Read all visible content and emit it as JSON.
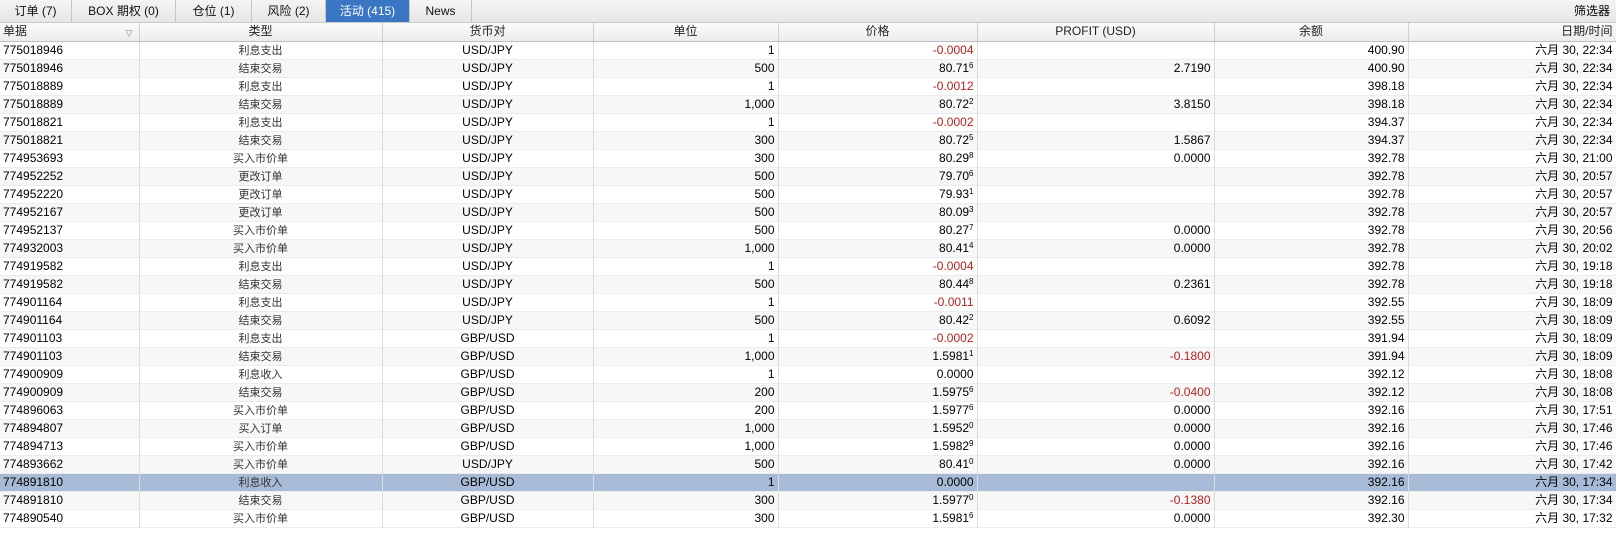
{
  "tabs": [
    {
      "label": "订单 (7)",
      "active": false
    },
    {
      "label": "BOX 期权 (0)",
      "active": false
    },
    {
      "label": "仓位 (1)",
      "active": false
    },
    {
      "label": "风险 (2)",
      "active": false
    },
    {
      "label": "活动 (415)",
      "active": true
    },
    {
      "label": "News",
      "active": false
    }
  ],
  "filter_label": "筛选器",
  "columns": [
    "单据",
    "类型",
    "货币对",
    "单位",
    "价格",
    "PROFIT (USD)",
    "余额",
    "日期/时间"
  ],
  "selected_row_id": "774891810",
  "rows": [
    {
      "id": "775018946",
      "type": "利息支出",
      "pair": "USD/JPY",
      "units": "1",
      "price": "-0.0004",
      "price_sup": "",
      "price_neg": true,
      "profit": "",
      "profit_neg": false,
      "balance": "400.90",
      "datetime": "六月 30, 22:34"
    },
    {
      "id": "775018946",
      "type": "结束交易",
      "pair": "USD/JPY",
      "units": "500",
      "price": "80.71",
      "price_sup": "6",
      "price_neg": false,
      "profit": "2.7190",
      "profit_neg": false,
      "balance": "400.90",
      "datetime": "六月 30, 22:34"
    },
    {
      "id": "775018889",
      "type": "利息支出",
      "pair": "USD/JPY",
      "units": "1",
      "price": "-0.0012",
      "price_sup": "",
      "price_neg": true,
      "profit": "",
      "profit_neg": false,
      "balance": "398.18",
      "datetime": "六月 30, 22:34"
    },
    {
      "id": "775018889",
      "type": "结束交易",
      "pair": "USD/JPY",
      "units": "1,000",
      "price": "80.72",
      "price_sup": "2",
      "price_neg": false,
      "profit": "3.8150",
      "profit_neg": false,
      "balance": "398.18",
      "datetime": "六月 30, 22:34"
    },
    {
      "id": "775018821",
      "type": "利息支出",
      "pair": "USD/JPY",
      "units": "1",
      "price": "-0.0002",
      "price_sup": "",
      "price_neg": true,
      "profit": "",
      "profit_neg": false,
      "balance": "394.37",
      "datetime": "六月 30, 22:34"
    },
    {
      "id": "775018821",
      "type": "结束交易",
      "pair": "USD/JPY",
      "units": "300",
      "price": "80.72",
      "price_sup": "5",
      "price_neg": false,
      "profit": "1.5867",
      "profit_neg": false,
      "balance": "394.37",
      "datetime": "六月 30, 22:34"
    },
    {
      "id": "774953693",
      "type": "买入市价单",
      "pair": "USD/JPY",
      "units": "300",
      "price": "80.29",
      "price_sup": "8",
      "price_neg": false,
      "profit": "0.0000",
      "profit_neg": false,
      "balance": "392.78",
      "datetime": "六月 30, 21:00"
    },
    {
      "id": "774952252",
      "type": "更改订单",
      "pair": "USD/JPY",
      "units": "500",
      "price": "79.70",
      "price_sup": "6",
      "price_neg": false,
      "profit": "",
      "profit_neg": false,
      "balance": "392.78",
      "datetime": "六月 30, 20:57"
    },
    {
      "id": "774952220",
      "type": "更改订单",
      "pair": "USD/JPY",
      "units": "500",
      "price": "79.93",
      "price_sup": "1",
      "price_neg": false,
      "profit": "",
      "profit_neg": false,
      "balance": "392.78",
      "datetime": "六月 30, 20:57"
    },
    {
      "id": "774952167",
      "type": "更改订单",
      "pair": "USD/JPY",
      "units": "500",
      "price": "80.09",
      "price_sup": "3",
      "price_neg": false,
      "profit": "",
      "profit_neg": false,
      "balance": "392.78",
      "datetime": "六月 30, 20:57"
    },
    {
      "id": "774952137",
      "type": "买入市价单",
      "pair": "USD/JPY",
      "units": "500",
      "price": "80.27",
      "price_sup": "7",
      "price_neg": false,
      "profit": "0.0000",
      "profit_neg": false,
      "balance": "392.78",
      "datetime": "六月 30, 20:56"
    },
    {
      "id": "774932003",
      "type": "买入市价单",
      "pair": "USD/JPY",
      "units": "1,000",
      "price": "80.41",
      "price_sup": "4",
      "price_neg": false,
      "profit": "0.0000",
      "profit_neg": false,
      "balance": "392.78",
      "datetime": "六月 30, 20:02"
    },
    {
      "id": "774919582",
      "type": "利息支出",
      "pair": "USD/JPY",
      "units": "1",
      "price": "-0.0004",
      "price_sup": "",
      "price_neg": true,
      "profit": "",
      "profit_neg": false,
      "balance": "392.78",
      "datetime": "六月 30, 19:18"
    },
    {
      "id": "774919582",
      "type": "结束交易",
      "pair": "USD/JPY",
      "units": "500",
      "price": "80.44",
      "price_sup": "8",
      "price_neg": false,
      "profit": "0.2361",
      "profit_neg": false,
      "balance": "392.78",
      "datetime": "六月 30, 19:18"
    },
    {
      "id": "774901164",
      "type": "利息支出",
      "pair": "USD/JPY",
      "units": "1",
      "price": "-0.0011",
      "price_sup": "",
      "price_neg": true,
      "profit": "",
      "profit_neg": false,
      "balance": "392.55",
      "datetime": "六月 30, 18:09"
    },
    {
      "id": "774901164",
      "type": "结束交易",
      "pair": "USD/JPY",
      "units": "500",
      "price": "80.42",
      "price_sup": "2",
      "price_neg": false,
      "profit": "0.6092",
      "profit_neg": false,
      "balance": "392.55",
      "datetime": "六月 30, 18:09"
    },
    {
      "id": "774901103",
      "type": "利息支出",
      "pair": "GBP/USD",
      "units": "1",
      "price": "-0.0002",
      "price_sup": "",
      "price_neg": true,
      "profit": "",
      "profit_neg": false,
      "balance": "391.94",
      "datetime": "六月 30, 18:09"
    },
    {
      "id": "774901103",
      "type": "结束交易",
      "pair": "GBP/USD",
      "units": "1,000",
      "price": "1.5981",
      "price_sup": "1",
      "price_neg": false,
      "profit": "-0.1800",
      "profit_neg": true,
      "balance": "391.94",
      "datetime": "六月 30, 18:09"
    },
    {
      "id": "774900909",
      "type": "利息收入",
      "pair": "GBP/USD",
      "units": "1",
      "price": "0.0000",
      "price_sup": "",
      "price_neg": false,
      "profit": "",
      "profit_neg": false,
      "balance": "392.12",
      "datetime": "六月 30, 18:08"
    },
    {
      "id": "774900909",
      "type": "结束交易",
      "pair": "GBP/USD",
      "units": "200",
      "price": "1.5975",
      "price_sup": "6",
      "price_neg": false,
      "profit": "-0.0400",
      "profit_neg": true,
      "balance": "392.12",
      "datetime": "六月 30, 18:08"
    },
    {
      "id": "774896063",
      "type": "买入市价单",
      "pair": "GBP/USD",
      "units": "200",
      "price": "1.5977",
      "price_sup": "6",
      "price_neg": false,
      "profit": "0.0000",
      "profit_neg": false,
      "balance": "392.16",
      "datetime": "六月 30, 17:51"
    },
    {
      "id": "774894807",
      "type": "买入订单",
      "pair": "GBP/USD",
      "units": "1,000",
      "price": "1.5952",
      "price_sup": "0",
      "price_neg": false,
      "profit": "0.0000",
      "profit_neg": false,
      "balance": "392.16",
      "datetime": "六月 30, 17:46"
    },
    {
      "id": "774894713",
      "type": "买入市价单",
      "pair": "GBP/USD",
      "units": "1,000",
      "price": "1.5982",
      "price_sup": "9",
      "price_neg": false,
      "profit": "0.0000",
      "profit_neg": false,
      "balance": "392.16",
      "datetime": "六月 30, 17:46"
    },
    {
      "id": "774893662",
      "type": "买入市价单",
      "pair": "USD/JPY",
      "units": "500",
      "price": "80.41",
      "price_sup": "0",
      "price_neg": false,
      "profit": "0.0000",
      "profit_neg": false,
      "balance": "392.16",
      "datetime": "六月 30, 17:42"
    },
    {
      "id": "774891810",
      "type": "利息收入",
      "pair": "GBP/USD",
      "units": "1",
      "price": "0.0000",
      "price_sup": "",
      "price_neg": false,
      "profit": "",
      "profit_neg": false,
      "balance": "392.16",
      "datetime": "六月 30, 17:34"
    },
    {
      "id": "774891810",
      "type": "结束交易",
      "pair": "GBP/USD",
      "units": "300",
      "price": "1.5977",
      "price_sup": "0",
      "price_neg": false,
      "profit": "-0.1380",
      "profit_neg": true,
      "balance": "392.16",
      "datetime": "六月 30, 17:34"
    },
    {
      "id": "774890540",
      "type": "买入市价单",
      "pair": "GBP/USD",
      "units": "300",
      "price": "1.5981",
      "price_sup": "6",
      "price_neg": false,
      "profit": "0.0000",
      "profit_neg": false,
      "balance": "392.30",
      "datetime": "六月 30, 17:32"
    }
  ],
  "colors": {
    "tab_active": "#3a76c4",
    "negative": "#b22222",
    "selected_row": "#a8bbd6"
  },
  "icons": {
    "sort": "sort-indicator-icon"
  }
}
